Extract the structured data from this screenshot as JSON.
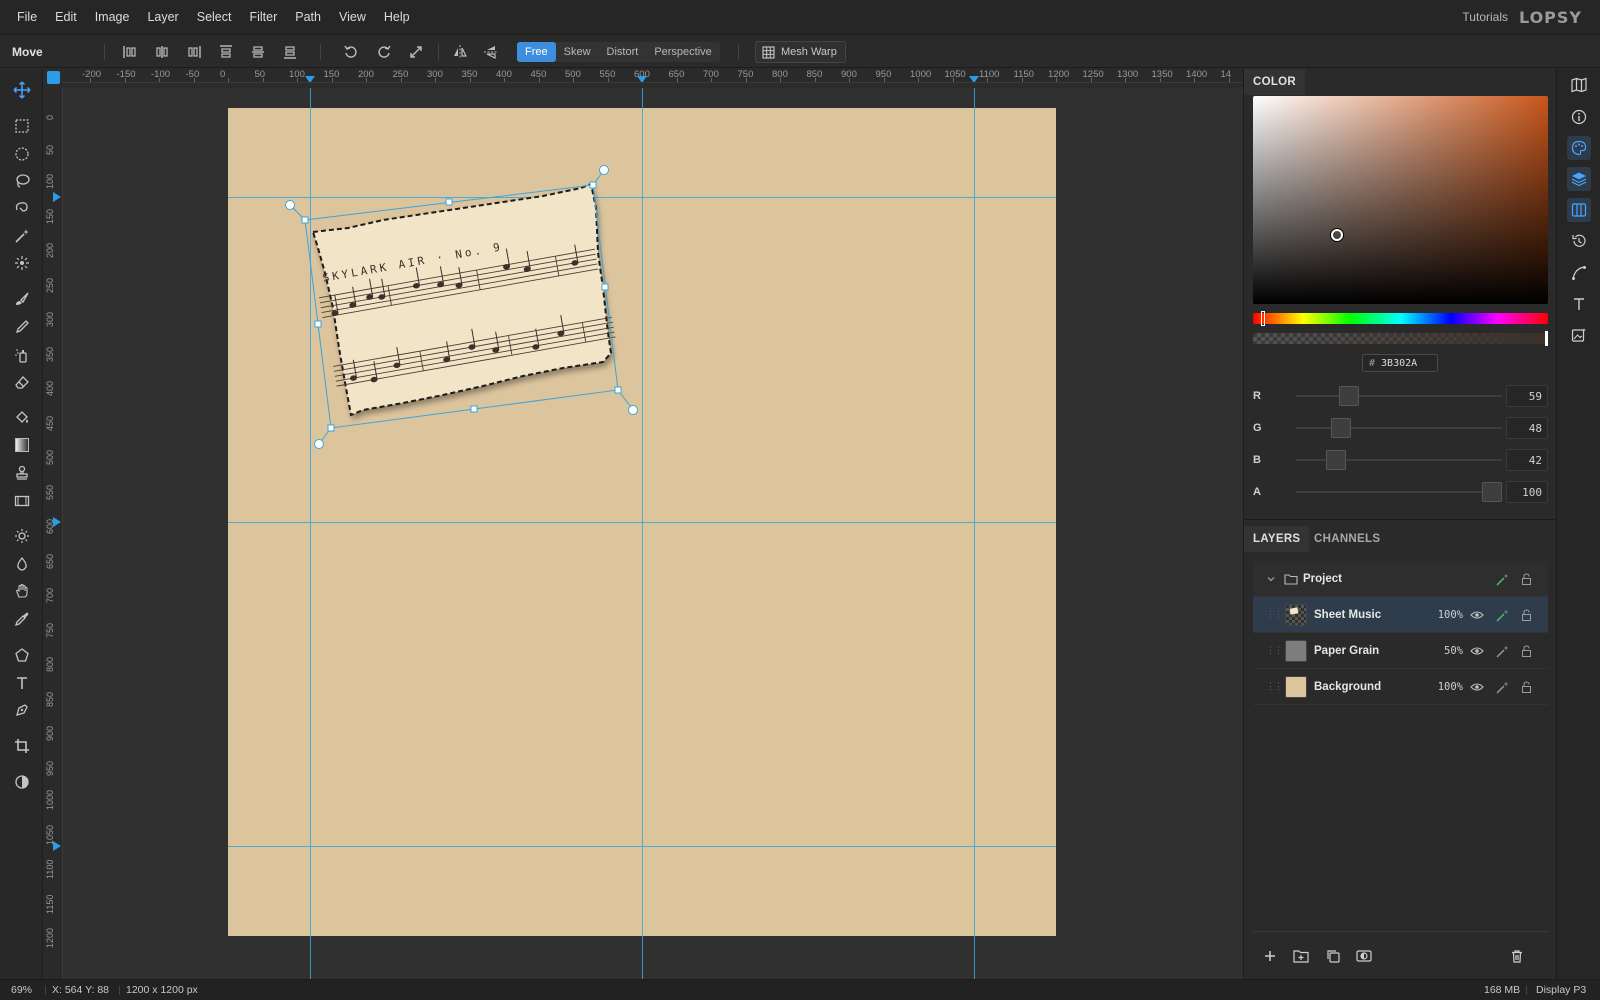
{
  "menu": [
    "File",
    "Edit",
    "Image",
    "Layer",
    "Select",
    "Filter",
    "Path",
    "View",
    "Help"
  ],
  "header": {
    "tutorials": "Tutorials",
    "brand": "LOPSY"
  },
  "options": {
    "tool_name": "Move",
    "modes": [
      "Free",
      "Skew",
      "Distort",
      "Perspective"
    ],
    "active_mode": "Free",
    "mesh_warp": "Mesh Warp"
  },
  "rulers": {
    "top_labels": [
      "-200",
      "-150",
      "-100",
      "-50",
      "0",
      "50",
      "100",
      "150",
      "200",
      "250",
      "300",
      "350",
      "400",
      "450",
      "500",
      "550",
      "600",
      "650",
      "700",
      "750",
      "800",
      "850",
      "900",
      "950",
      "1000",
      "1050",
      "1100",
      "1150",
      "1200",
      "1250",
      "1300",
      "1350",
      "1400",
      "14"
    ],
    "left_labels": [
      "0",
      "50",
      "100",
      "150",
      "200",
      "250",
      "300",
      "350",
      "400",
      "450",
      "500",
      "550",
      "600",
      "650",
      "700",
      "750",
      "800",
      "850",
      "900",
      "950",
      "1000",
      "1050",
      "1100",
      "1150",
      "1200"
    ]
  },
  "canvas": {
    "sheet_title": "SKYLARK AIR · No. 9",
    "artboard_color": "#dcc49d",
    "guide_color": "#3aa6de"
  },
  "color_panel": {
    "tab": "COLOR",
    "hex": "3B302A",
    "hex_prefix": "#",
    "channels": [
      {
        "label": "R",
        "value": "59",
        "fraction": 0.23
      },
      {
        "label": "G",
        "value": "48",
        "fraction": 0.19
      },
      {
        "label": "B",
        "value": "42",
        "fraction": 0.16
      },
      {
        "label": "A",
        "value": "100",
        "fraction": 1.0
      }
    ]
  },
  "layers_panel": {
    "tabs": [
      "LAYERS",
      "CHANNELS"
    ],
    "group_name": "Project",
    "layers": [
      {
        "name": "Sheet Music",
        "opacity": "100%",
        "selected": true
      },
      {
        "name": "Paper Grain",
        "opacity": "50%",
        "selected": false
      },
      {
        "name": "Background",
        "opacity": "100%",
        "selected": false
      }
    ]
  },
  "status": {
    "zoom": "69%",
    "coords": "X: 564 Y: 88",
    "dimensions": "1200 x 1200 px",
    "memory": "168 MB",
    "profile": "Display P3"
  },
  "colors": {
    "accent": "#3d8fdd",
    "selection_bg": "#2f3c4c",
    "fx_green": "#4cc26a"
  }
}
